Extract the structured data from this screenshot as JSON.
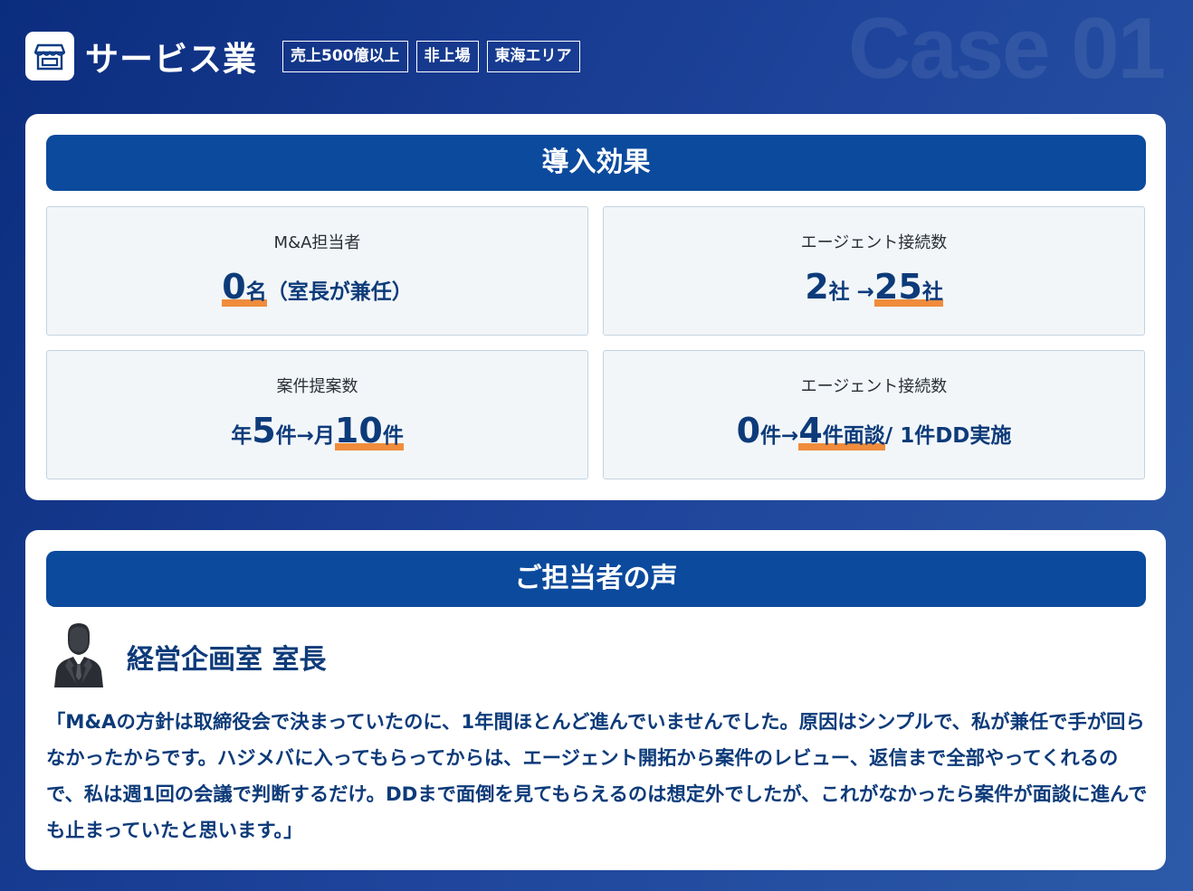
{
  "watermark": "Case 01",
  "header": {
    "title": "サービス業",
    "tags": [
      "売上500億以上",
      "非上場",
      "東海エリア"
    ]
  },
  "effects": {
    "title": "導入効果",
    "items": [
      {
        "label": "M&A担当者",
        "parts": [
          {
            "text": "0",
            "size": "big",
            "hl": true
          },
          {
            "text": "名",
            "size": "small",
            "hl": true
          },
          {
            "text": "（室長が兼任）",
            "size": "rest",
            "hl": false
          }
        ]
      },
      {
        "label": "エージェント接続数",
        "parts": [
          {
            "text": "2",
            "size": "big",
            "hl": false
          },
          {
            "text": "社 →",
            "size": "small",
            "hl": false
          },
          {
            "text": "25",
            "size": "big",
            "hl": true
          },
          {
            "text": "社",
            "size": "small",
            "hl": true
          }
        ]
      },
      {
        "label": "案件提案数",
        "parts": [
          {
            "text": "年",
            "size": "small",
            "hl": false
          },
          {
            "text": "5",
            "size": "big",
            "hl": false
          },
          {
            "text": "件→月",
            "size": "small",
            "hl": false
          },
          {
            "text": "10",
            "size": "big",
            "hl": true
          },
          {
            "text": "件",
            "size": "small",
            "hl": true
          }
        ]
      },
      {
        "label": "エージェント接続数",
        "parts": [
          {
            "text": "0",
            "size": "big",
            "hl": false
          },
          {
            "text": "件→",
            "size": "small",
            "hl": false
          },
          {
            "text": "4",
            "size": "big",
            "hl": true
          },
          {
            "text": "件面談",
            "size": "small",
            "hl": true
          },
          {
            "text": " / 1件DD実施",
            "size": "rest",
            "hl": false
          }
        ]
      }
    ]
  },
  "voice": {
    "title": "ご担当者の声",
    "role": "経営企画室 室長",
    "quote": "「M&Aの方針は取締役会で決まっていたのに、1年間ほとんど進んでいませんでした。原因はシンプルで、私が兼任で手が回らなかったからです。ハジメバに入ってもらってからは、エージェント開拓から案件のレビュー、返信まで全部やってくれるので、私は週1回の会議で判断するだけ。DDまで面倒を見てもらえるのは想定外でしたが、これがなかったら案件が面談に進んでも止まっていたと思います。」"
  },
  "colors": {
    "accent": "#0b4a9d",
    "text": "#0d3b7a",
    "highlight": "#f08c3c"
  },
  "icons": {
    "logo": "storefront-icon",
    "person": "businessman-icon"
  }
}
